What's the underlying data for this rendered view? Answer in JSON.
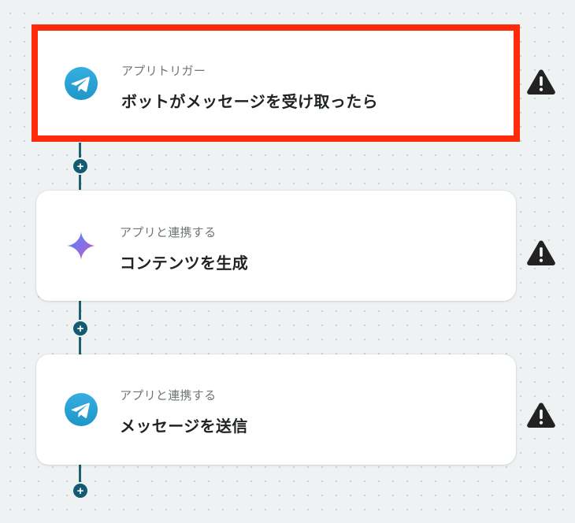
{
  "steps": [
    {
      "kicker": "アプリトリガー",
      "title": "ボットがメッセージを受け取ったら",
      "icon": "telegram-icon",
      "selected": true
    },
    {
      "kicker": "アプリと連携する",
      "title": "コンテンツを生成",
      "icon": "gemini-sparkle-icon",
      "selected": false
    },
    {
      "kicker": "アプリと連携する",
      "title": "メッセージを送信",
      "icon": "telegram-icon",
      "selected": false
    }
  ],
  "add_step_symbol": "+",
  "warning_symbol": "!",
  "colors": {
    "selected_border": "#ff2a0a",
    "connector": "#1f5f73",
    "add_button": "#125b72",
    "telegram": "#2aa3dc",
    "warning": "#222222"
  }
}
